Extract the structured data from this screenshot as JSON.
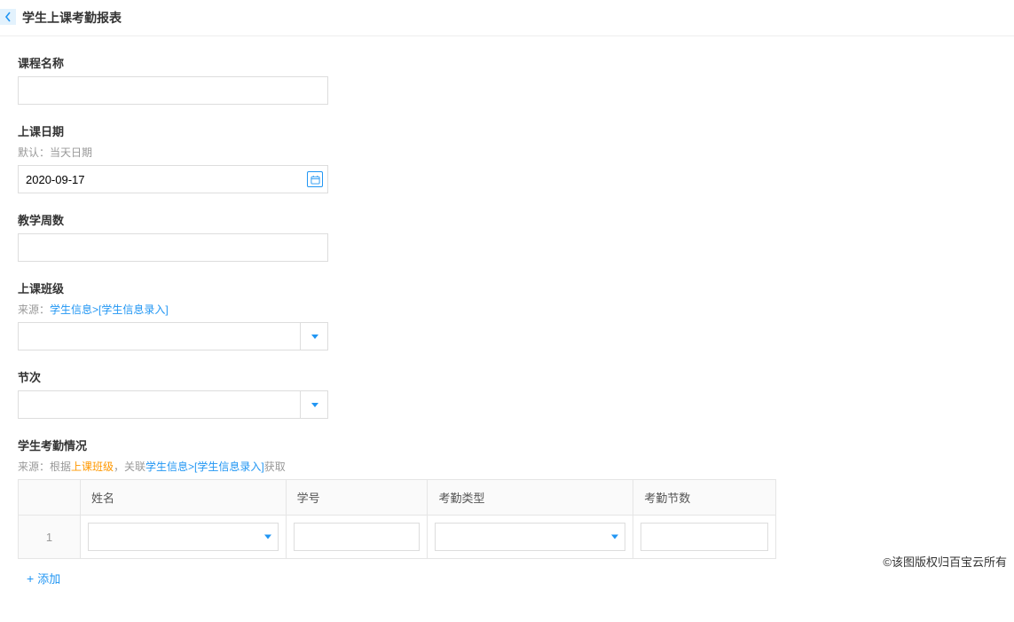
{
  "header": {
    "title": "学生上课考勤报表"
  },
  "fields": {
    "courseName": {
      "label": "课程名称",
      "value": ""
    },
    "classDate": {
      "label": "上课日期",
      "hint": "默认：当天日期",
      "value": "2020-09-17"
    },
    "weekNumber": {
      "label": "教学周数",
      "value": ""
    },
    "classGroup": {
      "label": "上课班级",
      "hintPrefix": "来源：",
      "hintLink": "学生信息>[学生信息录入]",
      "value": ""
    },
    "period": {
      "label": "节次",
      "value": ""
    },
    "attendance": {
      "label": "学生考勤情况",
      "hintPrefix": "来源：根据",
      "hintOrange": "上课班级",
      "hintMid": "，关联",
      "hintLink": "学生信息>[学生信息录入]",
      "hintSuffix": "获取"
    }
  },
  "table": {
    "headers": {
      "name": "姓名",
      "number": "学号",
      "type": "考勤类型",
      "count": "考勤节数"
    },
    "rows": [
      {
        "index": "1",
        "name": "",
        "number": "",
        "type": "",
        "count": ""
      }
    ]
  },
  "actions": {
    "add": "添加"
  },
  "footer": {
    "copyright": "©该图版权归百宝云所有"
  }
}
